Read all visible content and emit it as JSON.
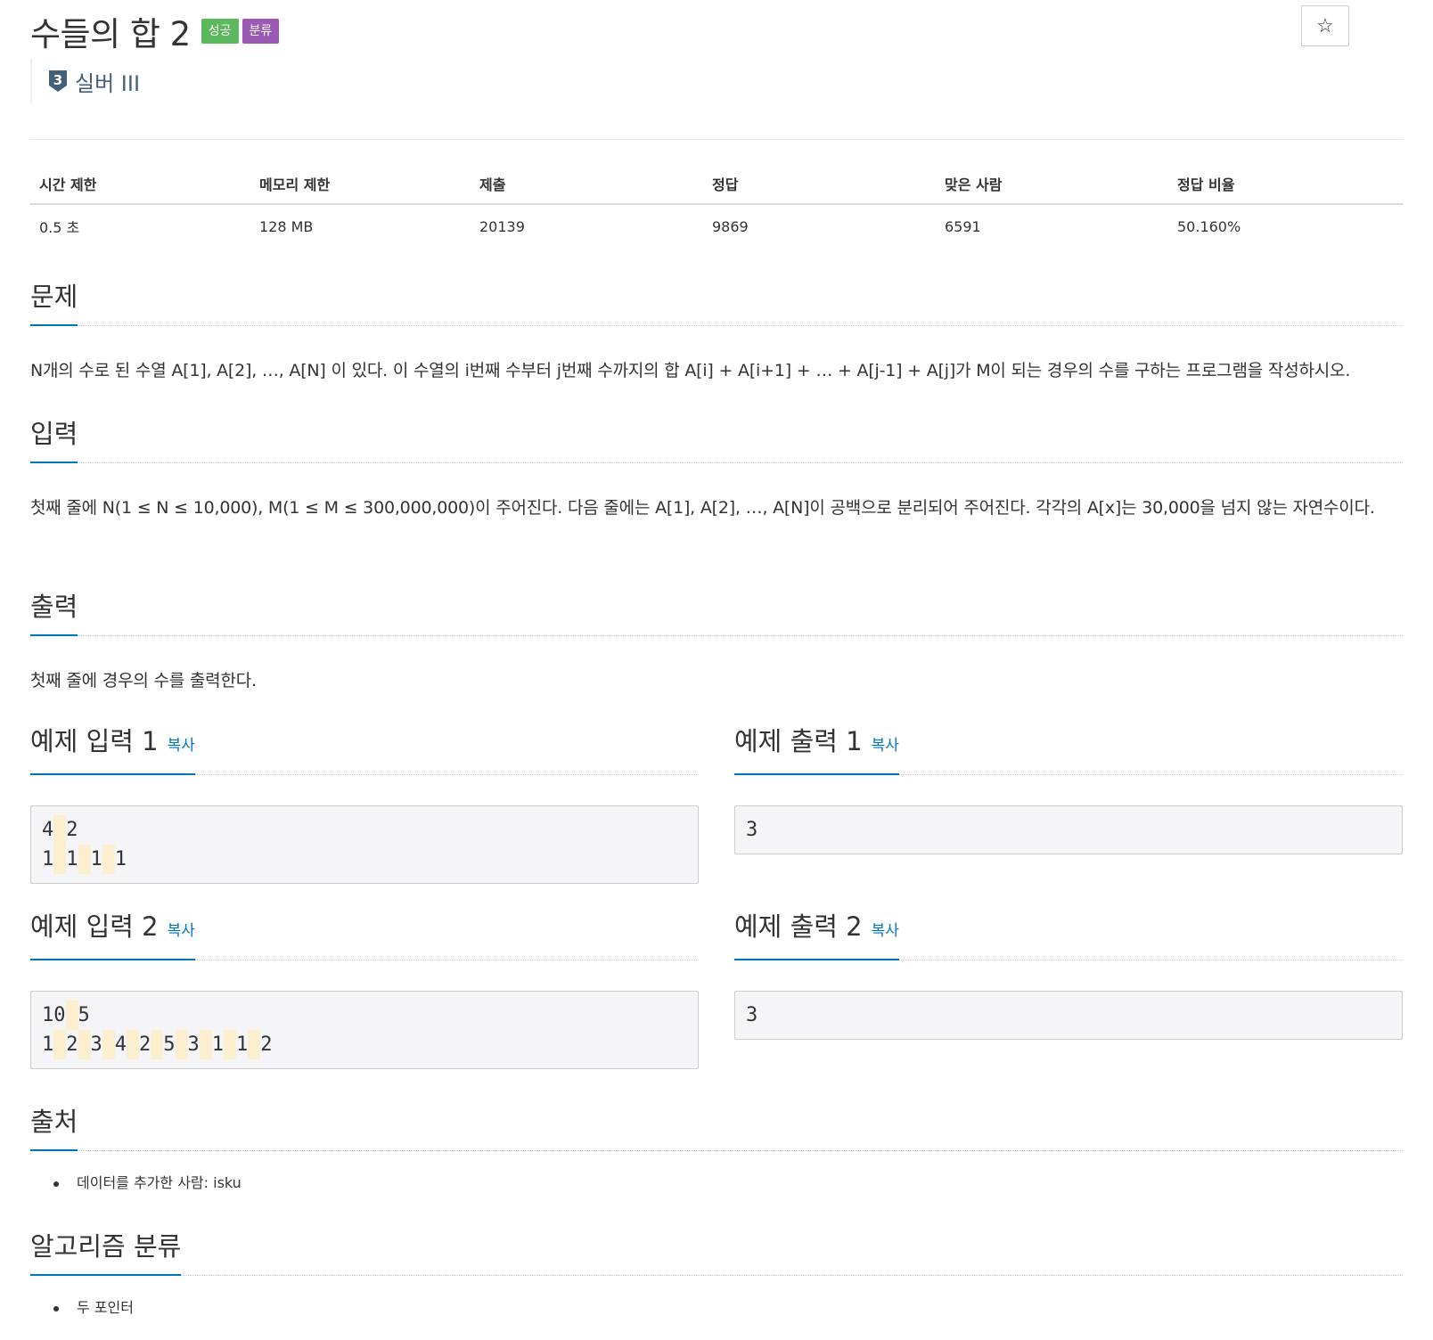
{
  "problem": {
    "title": "수들의 합 2",
    "badges": {
      "success": "성공",
      "category": "분류"
    },
    "star_icon": "star-icon",
    "tier": {
      "number": "3",
      "label": "실버 III",
      "color": "#435f7a"
    }
  },
  "stats": {
    "headers": [
      "시간 제한",
      "메모리 제한",
      "제출",
      "정답",
      "맞은 사람",
      "정답 비율"
    ],
    "values": [
      "0.5 초",
      "128 MB",
      "20139",
      "9869",
      "6591",
      "50.160%"
    ]
  },
  "sections": {
    "description": {
      "title": "문제",
      "text": "N개의 수로 된 수열 A[1], A[2], …, A[N] 이 있다. 이 수열의 i번째 수부터 j번째 수까지의 합 A[i] + A[i+1] + … + A[j-1] + A[j]가 M이 되는 경우의 수를 구하는 프로그램을 작성하시오."
    },
    "input": {
      "title": "입력",
      "text": "첫째 줄에 N(1 ≤ N ≤ 10,000), M(1 ≤ M ≤ 300,000,000)이 주어진다. 다음 줄에는 A[1], A[2], …, A[N]이 공백으로 분리되어 주어진다. 각각의 A[x]는 30,000을 넘지 않는 자연수이다."
    },
    "output": {
      "title": "출력",
      "text": "첫째 줄에 경우의 수를 출력한다."
    },
    "source": {
      "title": "출처",
      "items": [
        "데이터를 추가한 사람: isku"
      ]
    },
    "algorithm": {
      "title": "알고리즘 분류",
      "items": [
        "두 포인터"
      ]
    }
  },
  "copy_label": "복사",
  "samples": [
    {
      "input_title": "예제 입력 1",
      "input_lines": [
        [
          "4",
          "2"
        ],
        [
          "1",
          "1",
          "1",
          "1"
        ]
      ],
      "output_title": "예제 출력 1",
      "output_lines": [
        [
          "3"
        ]
      ]
    },
    {
      "input_title": "예제 입력 2",
      "input_lines": [
        [
          "10",
          "5"
        ],
        [
          "1",
          "2",
          "3",
          "4",
          "2",
          "5",
          "3",
          "1",
          "1",
          "2"
        ]
      ],
      "output_title": "예제 출력 2",
      "output_lines": [
        [
          "3"
        ]
      ]
    }
  ],
  "colors": {
    "accent": "#0076c0",
    "success": "#5cb85c",
    "category": "#9b59b6",
    "whitespace_highlight": "#fcefcf"
  }
}
